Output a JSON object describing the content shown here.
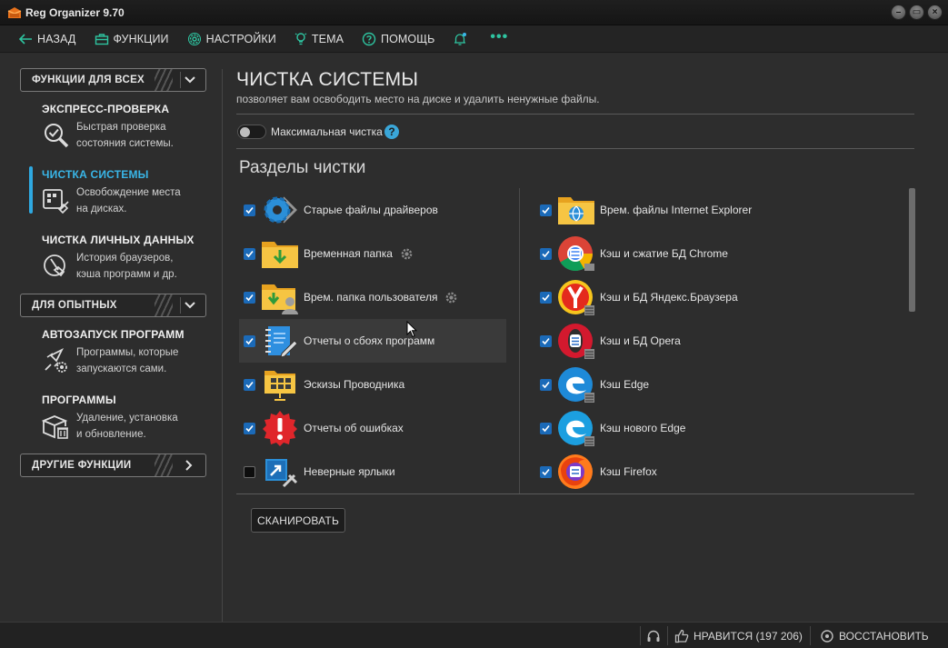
{
  "window": {
    "title": "Reg Organizer 9.70"
  },
  "toolbar": {
    "back": "НАЗАД",
    "functions": "ФУНКЦИИ",
    "settings": "НАСТРОЙКИ",
    "theme": "ТЕМА",
    "help": "ПОМОЩЬ",
    "more": "•••"
  },
  "sidebar": {
    "group1": "ФУНКЦИИ ДЛЯ ВСЕХ",
    "group2": "ДЛЯ ОПЫТНЫХ",
    "group3": "ДРУГИЕ ФУНКЦИИ",
    "items": [
      {
        "title": "ЭКСПРЕСС-ПРОВЕРКА",
        "line1": "Быстрая проверка",
        "line2": "состояния системы."
      },
      {
        "title": "ЧИСТКА СИСТЕМЫ",
        "line1": "Освобождение места",
        "line2": "на дисках."
      },
      {
        "title": "ЧИСТКА ЛИЧНЫХ ДАННЫХ",
        "line1": "История браузеров,",
        "line2": "кэша программ и др."
      },
      {
        "title": "АВТОЗАПУСК ПРОГРАММ",
        "line1": "Программы, которые",
        "line2": "запускаются сами."
      },
      {
        "title": "ПРОГРАММЫ",
        "line1": "Удаление, установка",
        "line2": "и обновление."
      }
    ]
  },
  "content": {
    "title": "ЧИСТКА СИСТЕМЫ",
    "subtitle": "позволяет вам освободить место на диске и удалить ненужные файлы.",
    "max_clean_label": "Максимальная чистка",
    "help_mark": "?",
    "sections_title": "Разделы чистки",
    "left_items": [
      {
        "label": "Старые файлы драйверов",
        "checked": true,
        "icon": "driver-gear-icon"
      },
      {
        "label": "Временная папка",
        "checked": true,
        "icon": "temp-folder-icon"
      },
      {
        "label": "Врем. папка пользователя",
        "checked": true,
        "icon": "user-folder-icon"
      },
      {
        "label": "Отчеты о сбоях программ",
        "checked": true,
        "icon": "crash-report-icon"
      },
      {
        "label": "Эскизы Проводника",
        "checked": true,
        "icon": "thumbnails-folder-icon"
      },
      {
        "label": "Отчеты об ошибках",
        "checked": true,
        "icon": "error-report-icon"
      },
      {
        "label": "Неверные ярлыки",
        "checked": false,
        "icon": "broken-shortcut-icon"
      }
    ],
    "right_items": [
      {
        "label": "Врем. файлы Internet Explorer",
        "checked": true,
        "icon": "ie-folder-icon"
      },
      {
        "label": "Кэш и сжатие БД Chrome",
        "checked": true,
        "icon": "chrome-icon"
      },
      {
        "label": "Кэш и БД Яндекс.Браузера",
        "checked": true,
        "icon": "yandex-browser-icon"
      },
      {
        "label": "Кэш и БД Opera",
        "checked": true,
        "icon": "opera-icon"
      },
      {
        "label": "Кэш Edge",
        "checked": true,
        "icon": "edge-icon"
      },
      {
        "label": "Кэш нового Edge",
        "checked": true,
        "icon": "new-edge-icon"
      },
      {
        "label": "Кэш Firefox",
        "checked": true,
        "icon": "firefox-icon"
      }
    ],
    "scan_button": "СКАНИРОВАТЬ"
  },
  "statusbar": {
    "like": "НРАВИТСЯ (197 206)",
    "restore": "ВОССТАНОВИТЬ"
  },
  "colors": {
    "accent": "#39b6e8",
    "checkbox": "#1b6ab8",
    "toolbar_icon": "#2ec4a0"
  }
}
